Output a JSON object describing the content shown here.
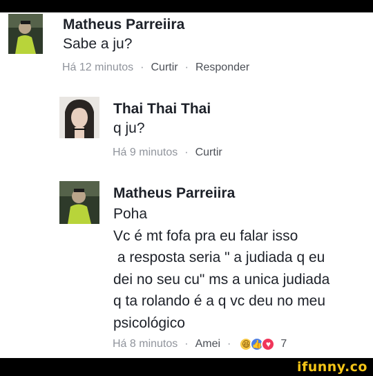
{
  "comments": [
    {
      "author": "Matheus Parreiira",
      "text": "Sabe a ju?",
      "time": "Há 12 minutos",
      "actions": [
        "Curtir",
        "Responder"
      ]
    },
    {
      "author": "Thai Thai Thai",
      "text": "q ju?",
      "time": "Há 9 minutos",
      "actions": [
        "Curtir"
      ]
    },
    {
      "author": "Matheus Parreiira",
      "lines": [
        "Poha",
        "Vc é mt fofa pra eu falar isso",
        " a resposta seria \" a judiada q eu",
        "dei no seu cu\" ms a unica judiada",
        "q ta rolando é a q vc deu no meu",
        "psicológico"
      ],
      "time": "Há 8 minutos",
      "reaction_label": "Amei",
      "reactions": [
        "haha-icon",
        "like-icon",
        "love-icon"
      ],
      "reaction_count": "7"
    }
  ],
  "separator": "·",
  "watermark": "ifunny.co",
  "colors": {
    "text": "#1d2129",
    "meta": "#90949c",
    "watermark": "#f5c518"
  }
}
